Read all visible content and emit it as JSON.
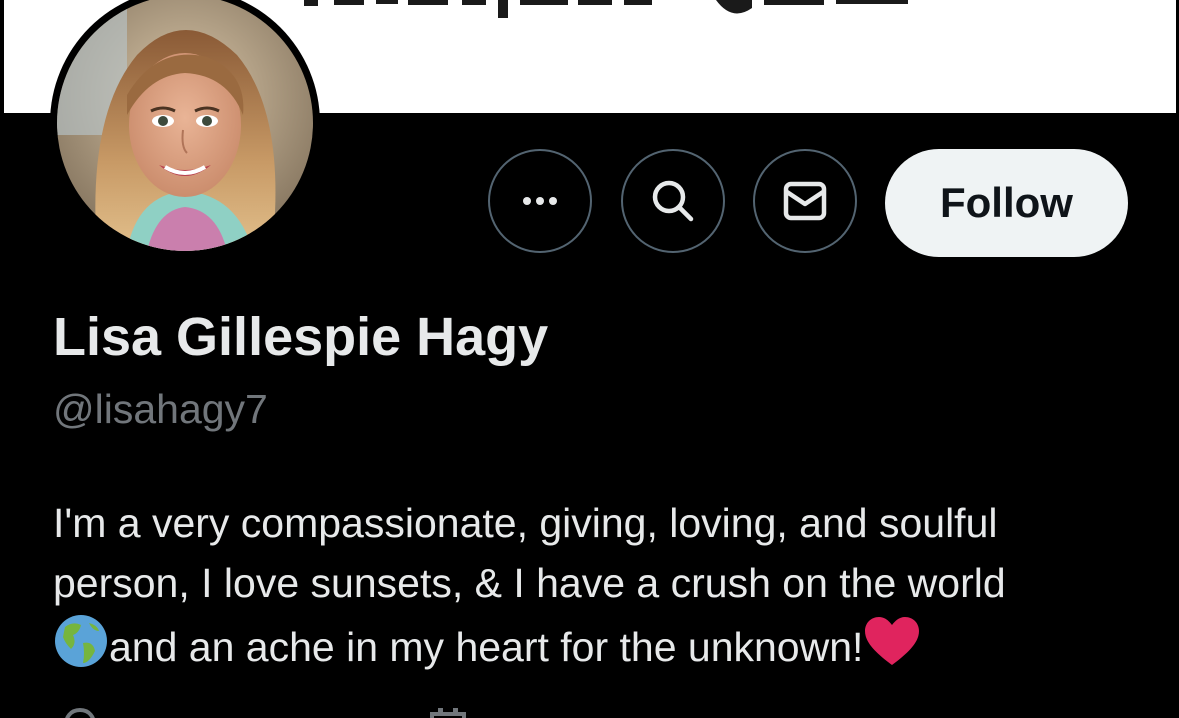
{
  "banner": {
    "visible_text_fragment": "·····························"
  },
  "avatar": {
    "alt": "Lisa Gillespie Hagy profile photo"
  },
  "actions": {
    "more_icon": "more-horizontal-icon",
    "search_icon": "search-icon",
    "message_icon": "envelope-icon",
    "follow_label": "Follow"
  },
  "profile": {
    "display_name": "Lisa Gillespie Hagy",
    "handle": "@lisahagy7",
    "bio_line_1": "I'm a very compassionate, giving, loving, and soulful",
    "bio_line_2": "person, I love sunsets, & I have a crush on the world",
    "bio_line_3": "and an ache in my heart for the unknown!"
  },
  "colors": {
    "background": "#000000",
    "primary_text": "#e7e9ea",
    "secondary_text": "#71767b",
    "button_border": "#536471",
    "follow_bg": "#eff3f4",
    "follow_text": "#0f1419",
    "heart": "#e0245e"
  },
  "icons": {
    "globe": "globe-americas-icon",
    "heart": "red-heart-icon",
    "location": "location-pin-icon",
    "calendar": "calendar-icon"
  }
}
